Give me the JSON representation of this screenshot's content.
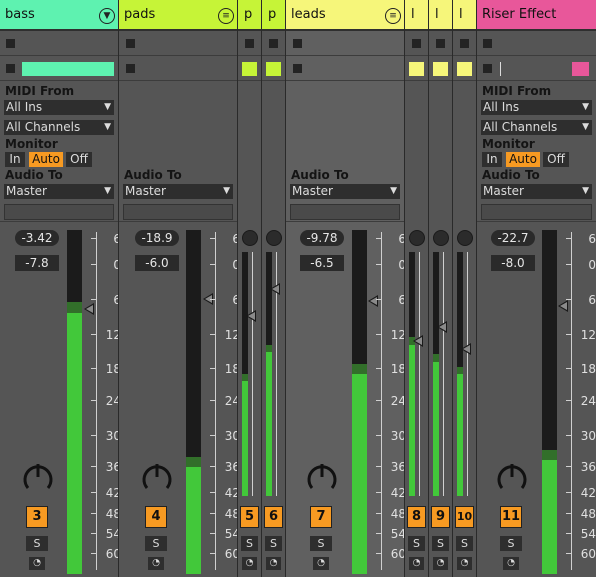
{
  "tracks": {
    "bass": {
      "name": "bass",
      "color": "#5ef2b0",
      "number": "3",
      "volume": "-3.42",
      "peak": "-7.8",
      "midi_from": "All Ins",
      "channel": "All Channels",
      "audio_to": "Master",
      "meter_fill": 0.76
    },
    "pads": {
      "name": "pads",
      "color": "#c6f437",
      "number": "4",
      "volume": "-18.9",
      "peak": "-6.0",
      "audio_to": "Master",
      "meter_fill": 0.31
    },
    "p5": {
      "name": "p",
      "color": "#c6f437",
      "number": "5",
      "meter_fill": 0.47
    },
    "p6": {
      "name": "p",
      "color": "#c6f437",
      "number": "6",
      "meter_fill": 0.59
    },
    "leads": {
      "name": "leads",
      "color": "#f6f67a",
      "number": "7",
      "volume": "-9.78",
      "peak": "-6.5",
      "audio_to": "Master",
      "meter_fill": 0.58
    },
    "l8": {
      "name": "l",
      "color": "#f6f67a",
      "number": "8",
      "meter_fill": 0.62
    },
    "l9": {
      "name": "l",
      "color": "#f6f67a",
      "number": "9",
      "meter_fill": 0.55
    },
    "l10": {
      "name": "l",
      "color": "#f6f67a",
      "number": "10",
      "meter_fill": 0.5
    },
    "riser": {
      "name": "Riser Effect",
      "color": "#e8579a",
      "number": "11",
      "volume": "-22.7",
      "peak": "-8.0",
      "midi_from": "All Ins",
      "channel": "All Channels",
      "audio_to": "Master",
      "meter_fill": 0.33
    }
  },
  "labels": {
    "midi_from": "MIDI From",
    "monitor": "Monitor",
    "audio_to": "Audio To",
    "mon_in": "In",
    "mon_auto": "Auto",
    "mon_off": "Off",
    "solo": "S",
    "rec": "◔"
  },
  "scale": [
    "6",
    "0",
    "6",
    "12",
    "18",
    "24",
    "30",
    "36",
    "42",
    "48",
    "54",
    "60"
  ]
}
